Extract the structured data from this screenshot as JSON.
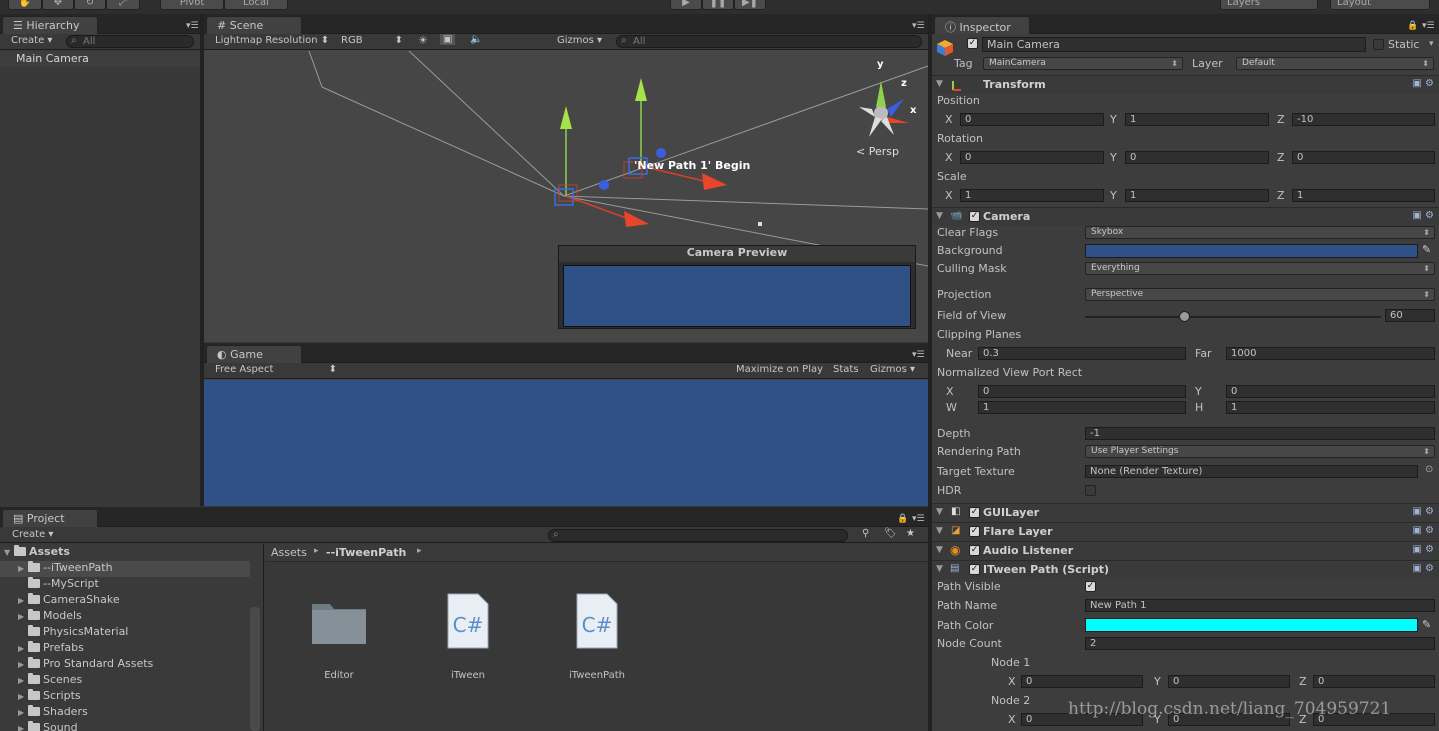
{
  "topbar": {
    "pivot": "Pivot",
    "local": "Local",
    "layers": "Layers",
    "layout": "Layout"
  },
  "hierarchy": {
    "tab": "Hierarchy",
    "create": "Create",
    "search_placeholder": "All",
    "items": [
      "Main Camera"
    ]
  },
  "scene": {
    "tab": "Scene",
    "lightmap": "Lightmap Resolution",
    "rgb": "RGB",
    "gizmos": "Gizmos",
    "search_placeholder": "All",
    "persp": "Persp",
    "path_label": "'New Path 1' Begin",
    "camera_preview": "Camera Preview",
    "gizmo_axes": {
      "y": "y",
      "z": "z",
      "x": "x"
    }
  },
  "game": {
    "tab": "Game",
    "aspect": "Free Aspect",
    "maximize": "Maximize on Play",
    "stats": "Stats",
    "gizmos": "Gizmos",
    "background_color": "#2f5186"
  },
  "project": {
    "tab": "Project",
    "create": "Create",
    "breadcrumb_root": "Assets",
    "breadcrumb_current": "--iTweenPath",
    "tree": [
      {
        "label": "Assets",
        "level": 0
      },
      {
        "label": "--iTweenPath",
        "level": 1,
        "selected": true
      },
      {
        "label": "--MyScript",
        "level": 1
      },
      {
        "label": "CameraShake",
        "level": 1
      },
      {
        "label": "Models",
        "level": 1
      },
      {
        "label": "PhysicsMaterial",
        "level": 1
      },
      {
        "label": "Prefabs",
        "level": 1
      },
      {
        "label": "Pro Standard Assets",
        "level": 1
      },
      {
        "label": "Scenes",
        "level": 1
      },
      {
        "label": "Scripts",
        "level": 1
      },
      {
        "label": "Shaders",
        "level": 1
      },
      {
        "label": "Sound",
        "level": 1
      }
    ],
    "files": [
      {
        "name": "Editor",
        "icon": "folder-icon"
      },
      {
        "name": "iTween",
        "icon": "csharp-icon"
      },
      {
        "name": "iTweenPath",
        "icon": "csharp-icon"
      }
    ]
  },
  "inspector": {
    "tab": "Inspector",
    "object_name": "Main Camera",
    "static": "Static",
    "tag_label": "Tag",
    "tag_value": "MainCamera",
    "layer_label": "Layer",
    "layer_value": "Default",
    "transform": {
      "title": "Transform",
      "position_label": "Position",
      "rotation_label": "Rotation",
      "scale_label": "Scale",
      "position": {
        "x": "0",
        "y": "1",
        "z": "-10"
      },
      "rotation": {
        "x": "0",
        "y": "0",
        "z": "0"
      },
      "scale": {
        "x": "1",
        "y": "1",
        "z": "1"
      },
      "axis_x": "X",
      "axis_y": "Y",
      "axis_z": "Z"
    },
    "camera": {
      "title": "Camera",
      "clear_flags_label": "Clear Flags",
      "clear_flags": "Skybox",
      "background_label": "Background",
      "background_color": "#2f5186",
      "culling_mask_label": "Culling Mask",
      "culling_mask": "Everything",
      "projection_label": "Projection",
      "projection": "Perspective",
      "fov_label": "Field of View",
      "fov": "60",
      "clipping_label": "Clipping Planes",
      "near_label": "Near",
      "near": "0.3",
      "far_label": "Far",
      "far": "1000",
      "viewport_label": "Normalized View Port Rect",
      "vp_x_label": "X",
      "vp_x": "0",
      "vp_y_label": "Y",
      "vp_y": "0",
      "vp_w_label": "W",
      "vp_w": "1",
      "vp_h_label": "H",
      "vp_h": "1",
      "depth_label": "Depth",
      "depth": "-1",
      "rendering_path_label": "Rendering Path",
      "rendering_path": "Use Player Settings",
      "target_texture_label": "Target Texture",
      "target_texture": "None (Render Texture)",
      "hdr_label": "HDR"
    },
    "guilayer": {
      "title": "GUILayer"
    },
    "flare": {
      "title": "Flare Layer"
    },
    "audio": {
      "title": "Audio Listener"
    },
    "itween": {
      "title": "ITween Path (Script)",
      "path_visible_label": "Path Visible",
      "path_name_label": "Path Name",
      "path_name": "New Path 1",
      "path_color_label": "Path Color",
      "path_color": "#00ffff",
      "node_count_label": "Node Count",
      "node_count": "2",
      "node1_label": "Node 1",
      "node1": {
        "x": "0",
        "y": "0",
        "z": "0"
      },
      "node2_label": "Node 2",
      "node2": {
        "x": "0",
        "y": "0",
        "z": "0"
      }
    }
  },
  "watermark": "http://blog.csdn.net/liang_704959721"
}
